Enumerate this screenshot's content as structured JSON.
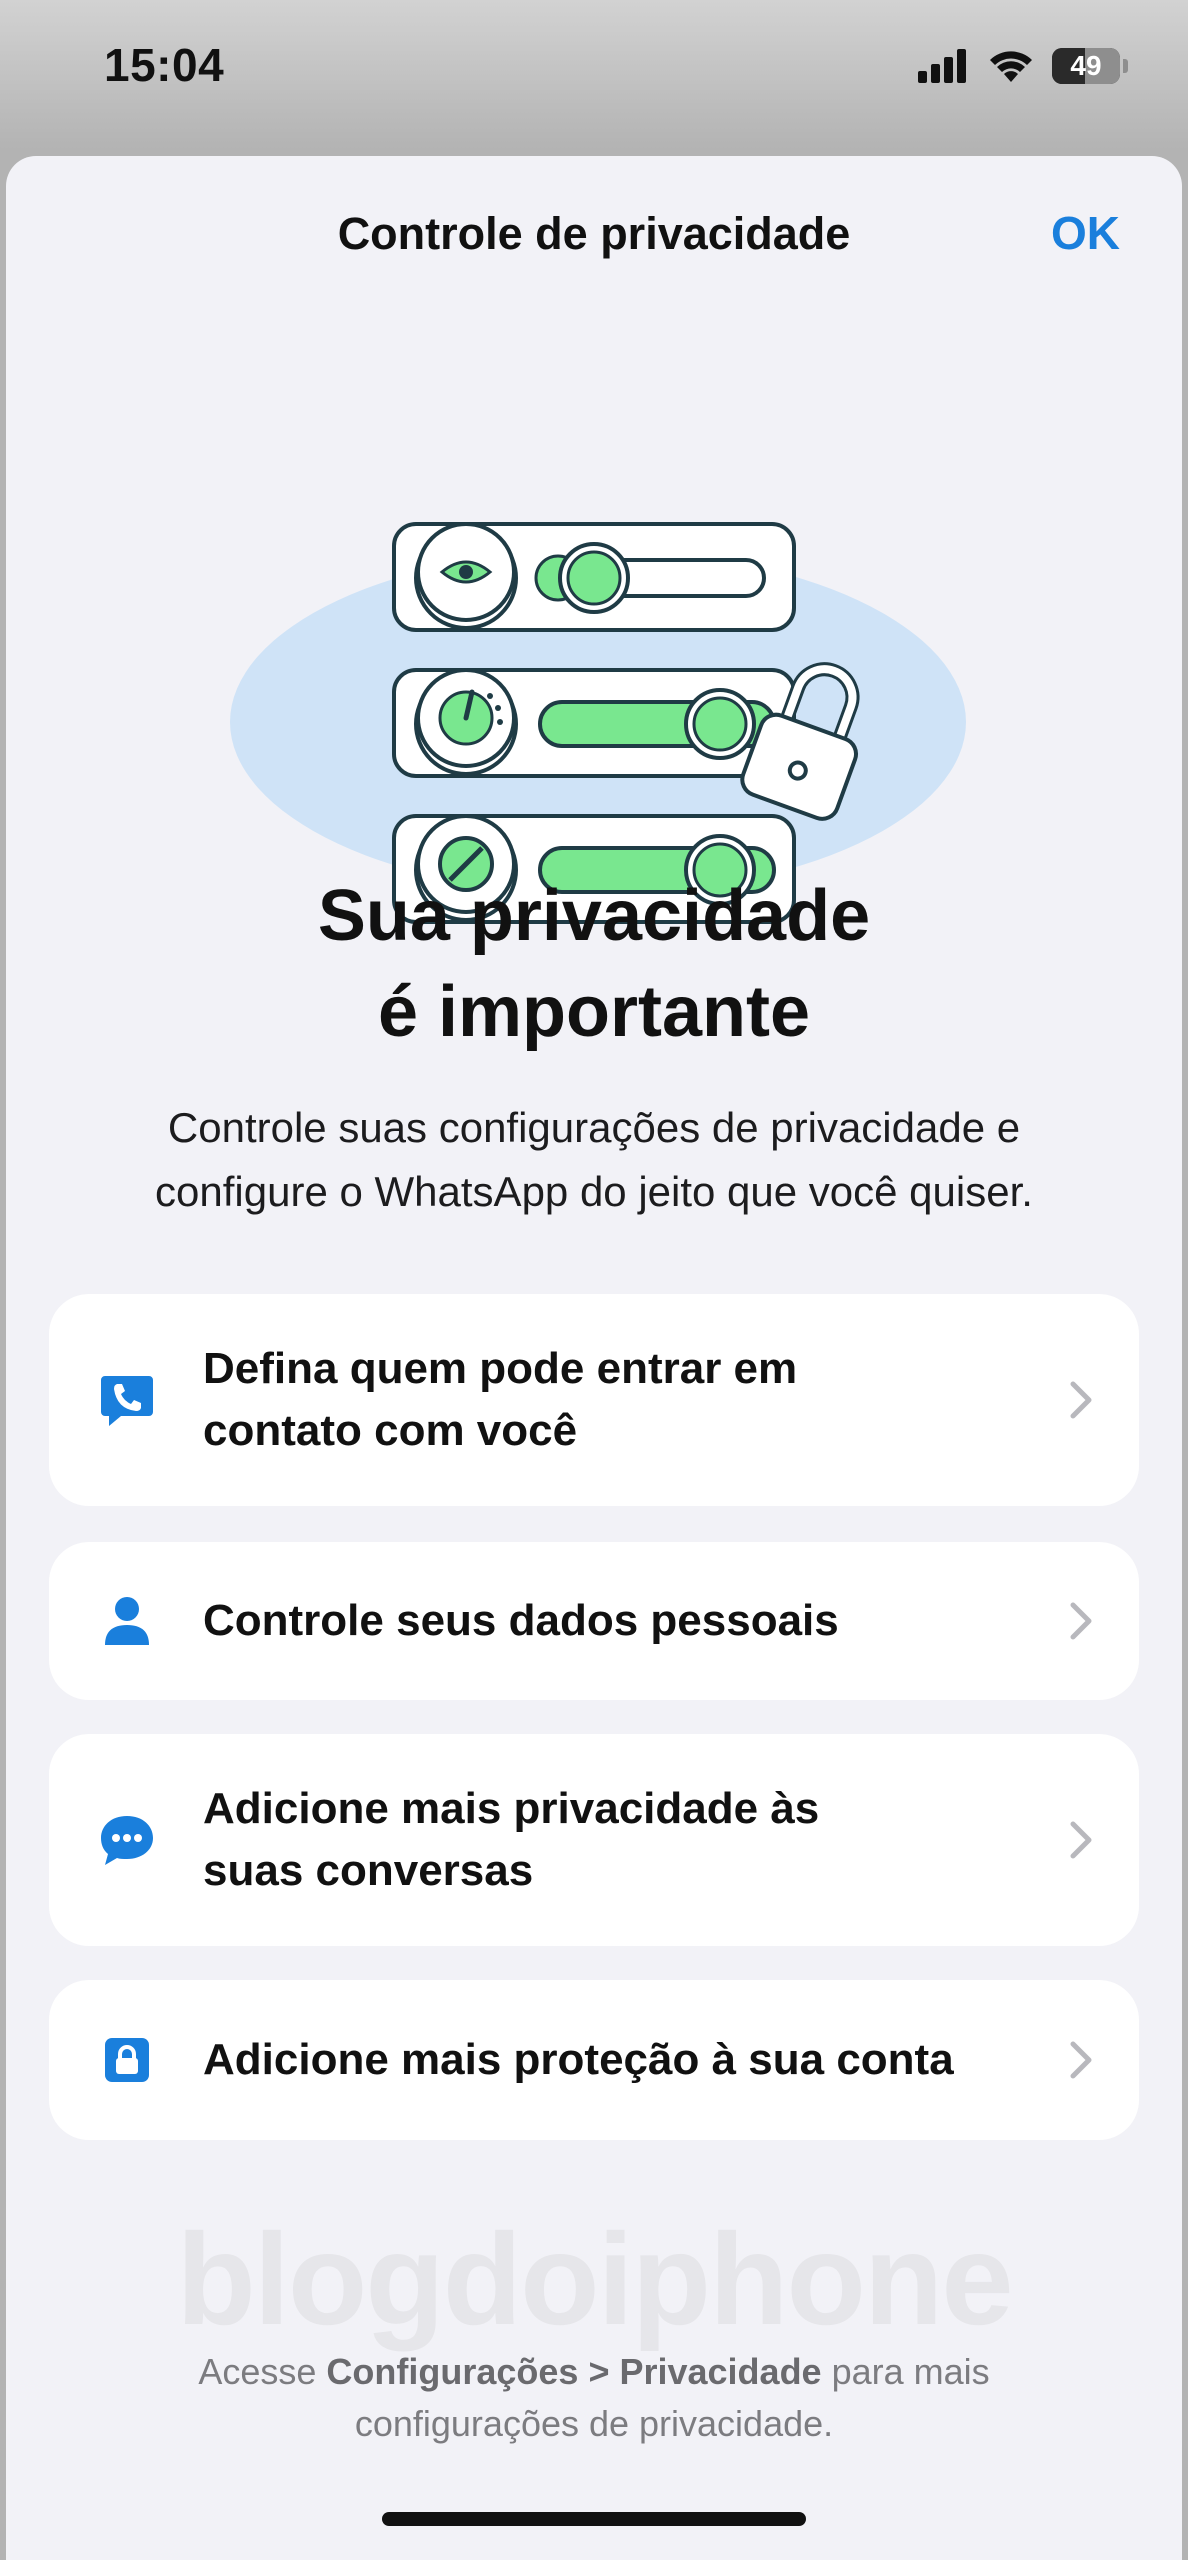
{
  "status_bar": {
    "time": "15:04",
    "battery": "49",
    "icons": [
      "cellular-signal-icon",
      "wifi-icon",
      "battery-icon"
    ]
  },
  "sheet": {
    "title": "Controle de privacidade",
    "ok_label": "OK",
    "accent_color": "#1a7fdc"
  },
  "headline": {
    "line1": "Sua privacidade",
    "line2": "é importante"
  },
  "subtitle": {
    "line1": "Controle suas configurações de privacidade e",
    "line2": "configure o WhatsApp do jeito que você quiser."
  },
  "options": [
    {
      "icon": "phone-bubble-icon",
      "line1": "Defina quem pode entrar em",
      "line2": "contato com você"
    },
    {
      "icon": "person-icon",
      "line1": "Controle seus dados pessoais"
    },
    {
      "icon": "chat-bubble-icon",
      "line1": "Adicione mais privacidade às",
      "line2": "suas conversas"
    },
    {
      "icon": "lock-icon",
      "line1": "Adicione mais proteção à sua conta"
    }
  ],
  "watermark": "blogdoiphone",
  "footnote": {
    "prefix": "Acesse ",
    "bold1": "Configurações",
    "sep": " > ",
    "bold2": "Privacidade",
    "suffix": " para mais",
    "line2": "configurações de privacidade."
  }
}
